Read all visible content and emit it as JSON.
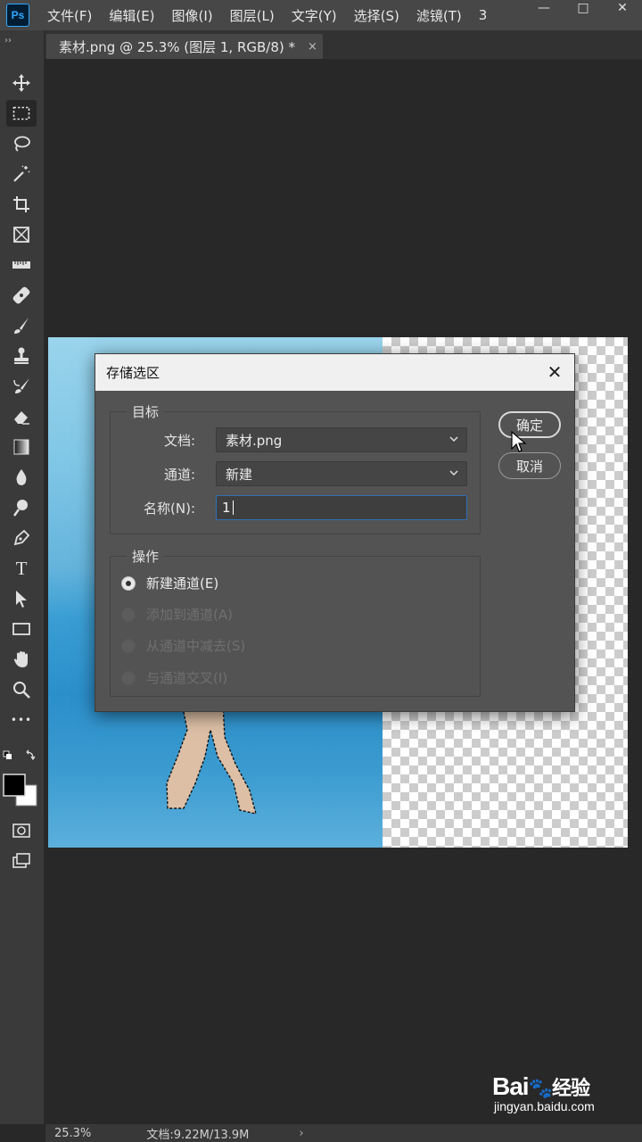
{
  "app": {
    "logo_text": "Ps"
  },
  "menubar": {
    "items": [
      "文件(F)",
      "编辑(E)",
      "图像(I)",
      "图层(L)",
      "文字(Y)",
      "选择(S)",
      "滤镜(T)",
      "3"
    ]
  },
  "window_controls": {
    "minimize": "—",
    "maximize": "□",
    "close": "✕"
  },
  "tab": {
    "title": "素材.png @ 25.3% (图层 1, RGB/8) *",
    "close": "×"
  },
  "toolbar": {
    "collapse": "››",
    "tools": [
      "move",
      "rect-marquee",
      "lasso",
      "magic-wand",
      "crop",
      "frame",
      "ruler",
      "healing-brush",
      "brush",
      "clone-stamp",
      "history-brush",
      "eraser",
      "gradient",
      "blur",
      "dodge",
      "pen",
      "type",
      "path-selection",
      "rectangle",
      "hand",
      "zoom",
      "more",
      "swap-colors",
      "foreground-background",
      "quick-mask",
      "screen-mode"
    ],
    "type_glyph": "T",
    "more_glyph": "•••"
  },
  "dialog": {
    "title": "存储选区",
    "close": "✕",
    "target_group": {
      "label": "目标",
      "document_label": "文档:",
      "document_value": "素材.png",
      "channel_label": "通道:",
      "channel_value": "新建",
      "name_label": "名称(N):",
      "name_value": "1"
    },
    "operation_group": {
      "label": "操作",
      "options": [
        {
          "label": "新建通道(E)",
          "selected": true,
          "enabled": true
        },
        {
          "label": "添加到通道(A)",
          "selected": false,
          "enabled": false
        },
        {
          "label": "从通道中减去(S)",
          "selected": false,
          "enabled": false
        },
        {
          "label": "与通道交叉(I)",
          "selected": false,
          "enabled": false
        }
      ]
    },
    "ok_button": "确定",
    "cancel_button": "取消"
  },
  "statusbar": {
    "zoom": "25.3%",
    "doc_info": "文档:9.22M/13.9M",
    "arrow": "›"
  },
  "watermark": {
    "logo": "Bai",
    "logo_suffix": "经验",
    "url": "jingyan.baidu.com"
  }
}
